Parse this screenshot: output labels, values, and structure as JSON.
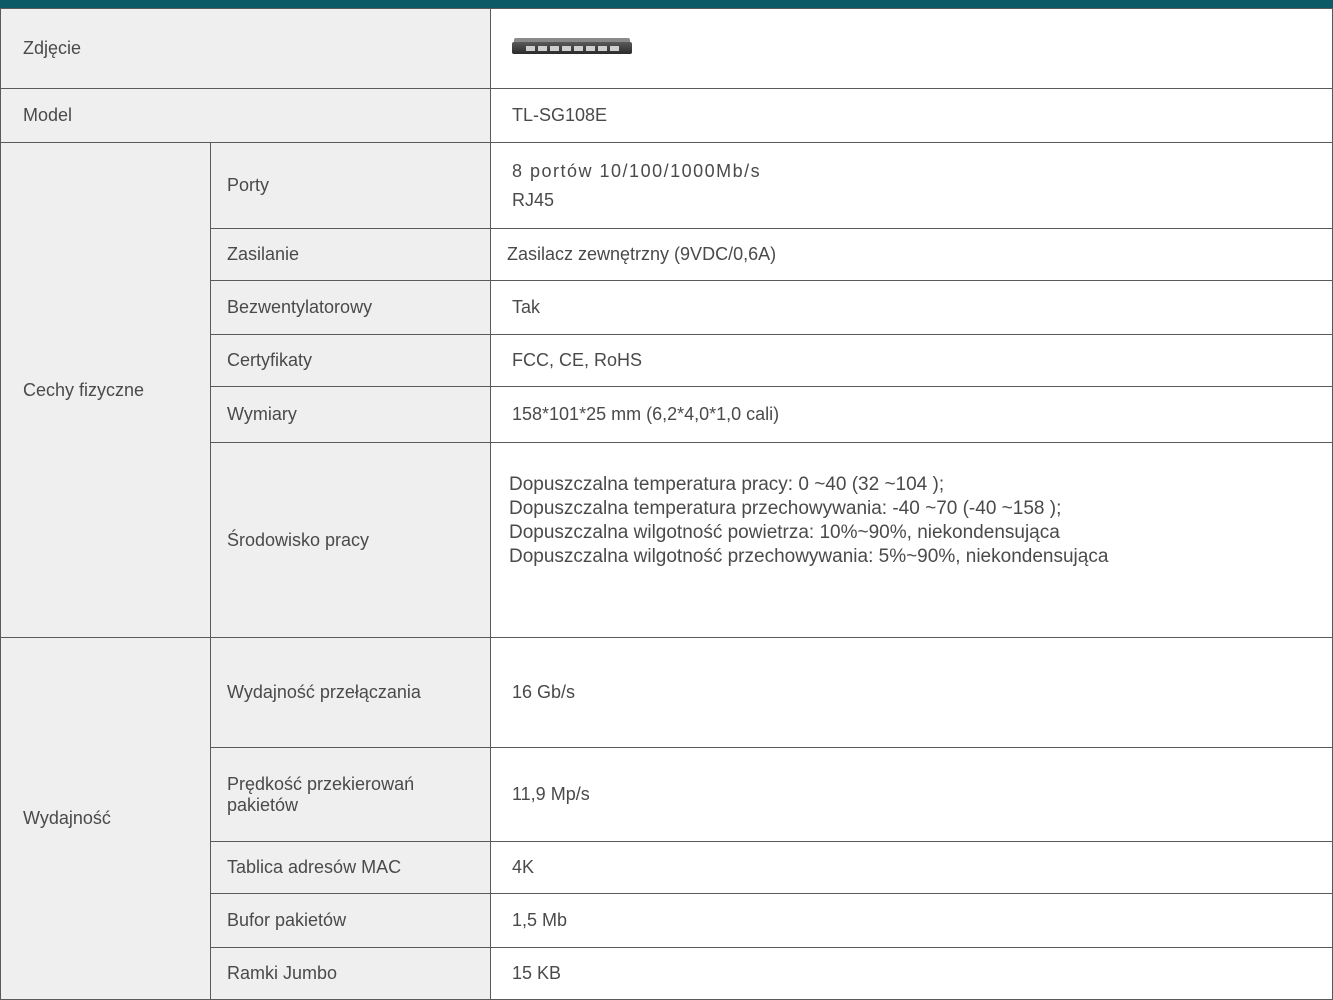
{
  "rows": {
    "photo_label": "Zdjęcie",
    "photo_icon": "network-switch-image",
    "model_label": "Model",
    "model_value": "TL-SG108E",
    "group_physical": "Cechy fizyczne",
    "ports_label": "Porty",
    "ports_value_line1": "8 portów 10/100/1000Mb/s",
    "ports_value_line2": "RJ45",
    "power_label": "Zasilanie",
    "power_value": "Zasilacz zewnętrzny (9VDC/0,6A)",
    "fanless_label": "Bezwentylatorowy",
    "fanless_value": "Tak",
    "cert_label": "Certyfikaty",
    "cert_value": "FCC, CE, RoHS",
    "dim_label": "Wymiary",
    "dim_value": "158*101*25 mm (6,2*4,0*1,0 cali)",
    "env_label": "Środowisko pracy",
    "env_values": [
      "Dopuszczalna temperatura pracy: 0 ~40 (32 ~104 );",
      "Dopuszczalna temperatura przechowywania: -40 ~70 (-40 ~158 );",
      "Dopuszczalna wilgotność powietrza: 10%~90%, niekondensująca",
      "Dopuszczalna wilgotność przechowywania: 5%~90%, niekondensująca"
    ],
    "group_performance": "Wydajność",
    "switching_label": "Wydajność przełączania",
    "switching_value": "16 Gb/s",
    "forwarding_label": "Prędkość przekierowań pakietów",
    "forwarding_value": "11,9 Mp/s",
    "mac_label": "Tablica adresów MAC",
    "mac_value": "4K",
    "buffer_label": "Bufor pakietów",
    "buffer_value": "1,5 Mb",
    "jumbo_label": "Ramki Jumbo",
    "jumbo_value": "15 KB"
  },
  "colors": {
    "header_bar": "#0b5a66",
    "label_bg": "#efefef",
    "border": "#5a5a5a",
    "text": "#4a4a4a"
  }
}
